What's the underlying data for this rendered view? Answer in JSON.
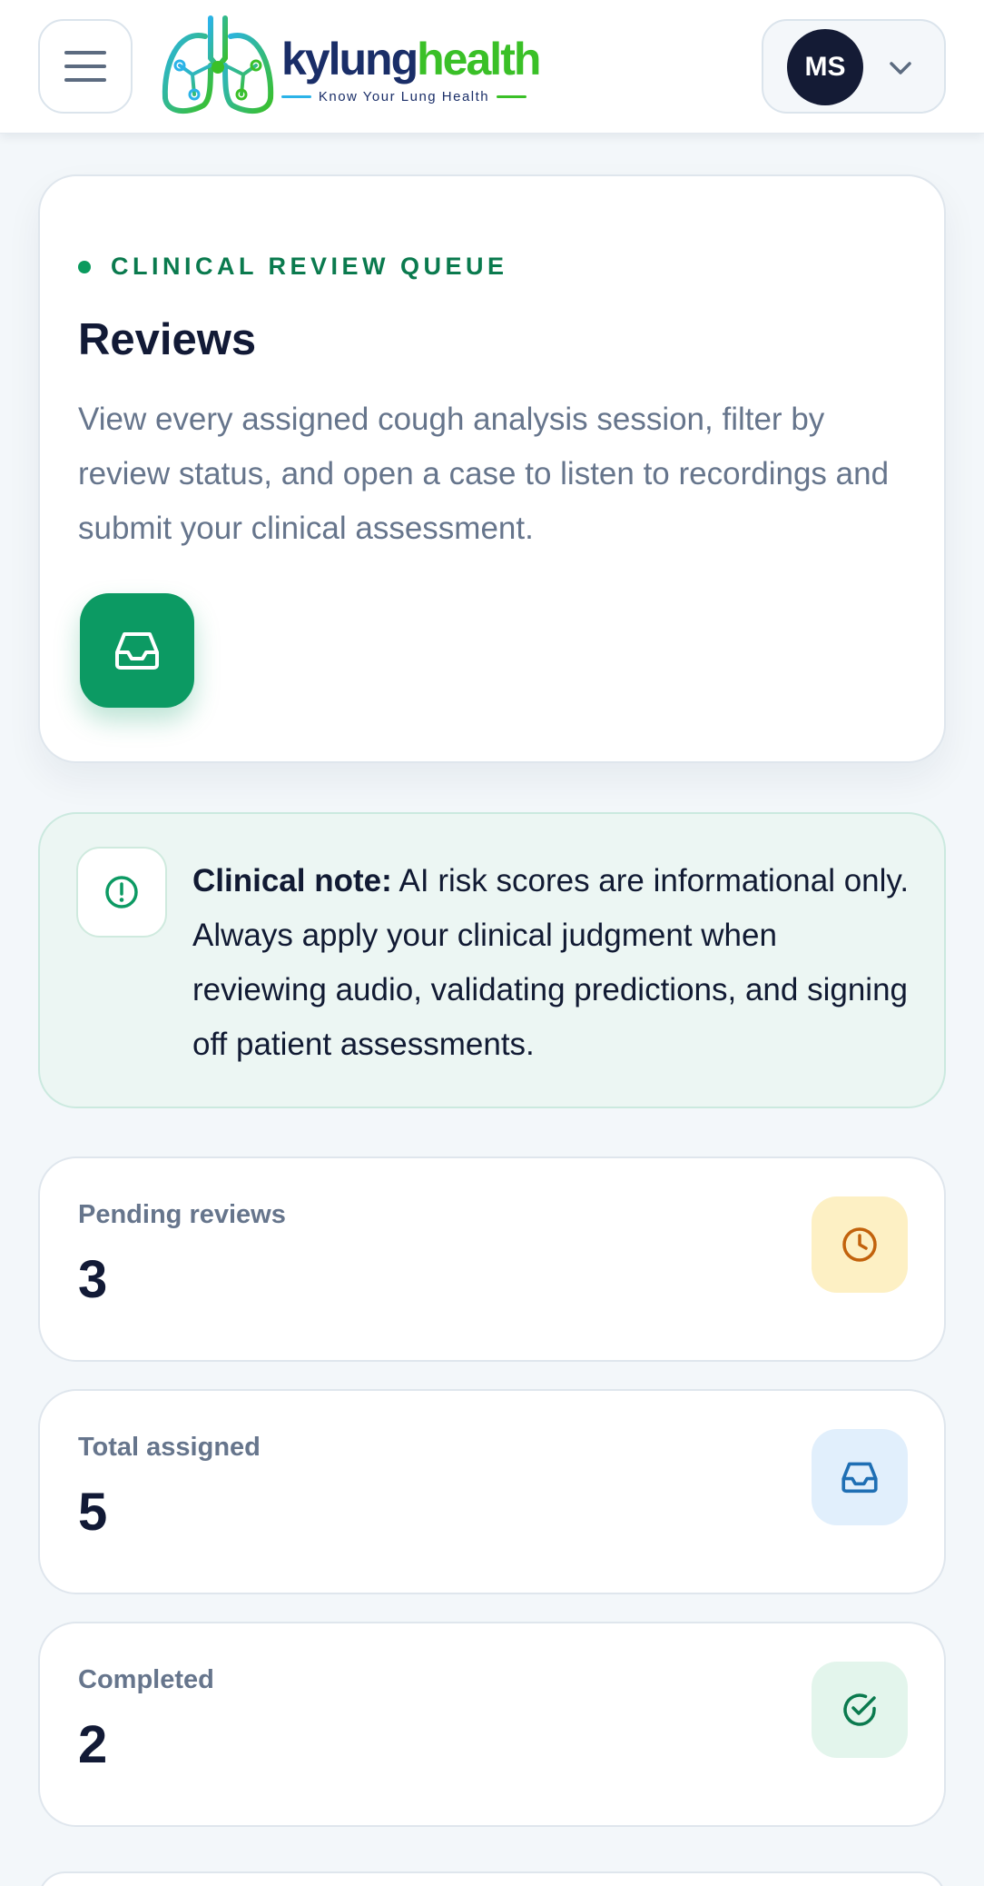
{
  "header": {
    "logo": {
      "wordmark_part1": "kylung",
      "wordmark_part2": "health",
      "tagline": "Know Your Lung Health"
    },
    "user": {
      "initials": "MS"
    }
  },
  "hero": {
    "eyebrow": "CLINICAL REVIEW QUEUE",
    "title": "Reviews",
    "description": "View every assigned cough analysis session, filter by review status, and open a case to listen to recordings and submit your clinical assessment.",
    "icon": "inbox-icon"
  },
  "note": {
    "label": "Clinical note:",
    "text": " AI risk scores are informational only. Always apply your clinical judgment when reviewing audio, validating predictions, and signing off patient assessments.",
    "icon": "alert-circle-icon"
  },
  "stats": [
    {
      "label": "Pending reviews",
      "value": "3",
      "icon": "clock-icon",
      "color": "#c2620c"
    },
    {
      "label": "Total assigned",
      "value": "5",
      "icon": "inbox-icon",
      "color": "#1f6fb4"
    },
    {
      "label": "Completed",
      "value": "2",
      "icon": "check-circle-icon",
      "color": "#0a7a4e"
    }
  ],
  "colors": {
    "accent": "#0c9a63",
    "navy": "#141b35",
    "logo_blue": "#1a2e68",
    "logo_green": "#3ac027"
  }
}
